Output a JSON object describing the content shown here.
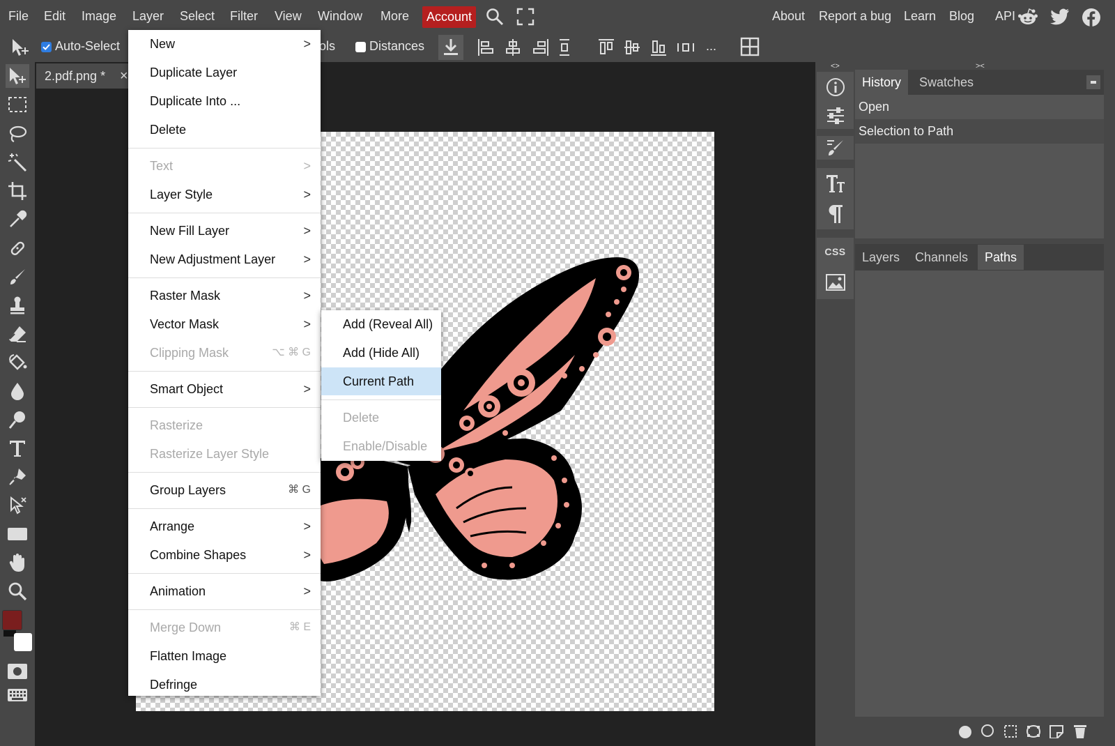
{
  "menubar": {
    "items": [
      "File",
      "Edit",
      "Image",
      "Layer",
      "Select",
      "Filter",
      "View",
      "Window",
      "More"
    ],
    "account": "Account",
    "right_links": [
      "About",
      "Report a bug",
      "Learn",
      "Blog",
      "API"
    ],
    "icons": [
      "search-icon",
      "fullscreen-icon",
      "reddit-icon",
      "twitter-icon",
      "facebook-icon"
    ],
    "account_color": "#b51f1f"
  },
  "options": {
    "auto_select_label": "Auto-Select",
    "controls_fragment": "ols",
    "distances_label": "Distances",
    "more_label": "..."
  },
  "doc_tab": {
    "name": "2.pdf.png *",
    "close": "×"
  },
  "right_panel": {
    "collapse_left": "<>",
    "collapse_right": "><",
    "top_tabs": [
      "History",
      "Swatches"
    ],
    "history": [
      "Open",
      "Selection to Path"
    ],
    "bottom_tabs": [
      "Layers",
      "Channels",
      "Paths"
    ],
    "css_label": "CSS"
  },
  "layer_menu": {
    "items": [
      {
        "label": "New",
        "arrow": ">",
        "disabled": false
      },
      {
        "label": "Duplicate Layer",
        "disabled": false
      },
      {
        "label": "Duplicate Into ...",
        "disabled": false
      },
      {
        "label": "Delete",
        "disabled": false
      },
      {
        "label": "Text",
        "arrow": ">",
        "disabled": true
      },
      {
        "label": "Layer Style",
        "arrow": ">",
        "disabled": false
      },
      {
        "label": "New Fill Layer",
        "arrow": ">",
        "disabled": false
      },
      {
        "label": "New Adjustment Layer",
        "arrow": ">",
        "disabled": false
      },
      {
        "label": "Raster Mask",
        "arrow": ">",
        "disabled": false
      },
      {
        "label": "Vector Mask",
        "arrow": ">",
        "disabled": false
      },
      {
        "label": "Clipping Mask",
        "shortcut": "⌥ ⌘ G",
        "disabled": true
      },
      {
        "label": "Smart Object",
        "arrow": ">",
        "disabled": false
      },
      {
        "label": "Rasterize",
        "disabled": true
      },
      {
        "label": "Rasterize Layer Style",
        "disabled": true
      },
      {
        "label": "Group Layers",
        "shortcut": "⌘ G",
        "disabled": false
      },
      {
        "label": "Arrange",
        "arrow": ">",
        "disabled": false
      },
      {
        "label": "Combine Shapes",
        "arrow": ">",
        "disabled": false
      },
      {
        "label": "Animation",
        "arrow": ">",
        "disabled": false
      },
      {
        "label": "Merge Down",
        "shortcut": "⌘ E",
        "disabled": true
      },
      {
        "label": "Flatten Image",
        "disabled": false
      },
      {
        "label": "Defringe",
        "disabled": false
      }
    ]
  },
  "vector_mask_submenu": {
    "items": [
      {
        "label": "Add (Reveal All)",
        "disabled": false
      },
      {
        "label": "Add (Hide All)",
        "disabled": false
      },
      {
        "label": "Current Path",
        "disabled": false,
        "highlighted": true
      },
      {
        "label": "Delete",
        "disabled": true
      },
      {
        "label": "Enable/Disable",
        "disabled": true
      }
    ]
  },
  "colors": {
    "foreground": "#7a1e1e",
    "background": "#ffffff",
    "wing_pink": "#ef9a8e",
    "highlight": "#cde4f7"
  }
}
